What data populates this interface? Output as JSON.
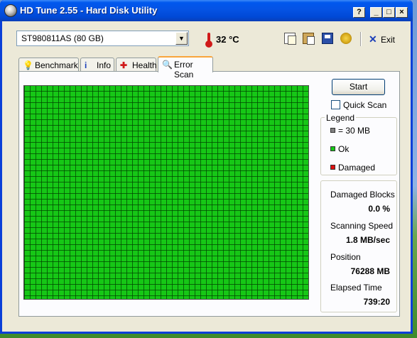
{
  "window": {
    "title": "HD Tune 2.55 - Hard Disk Utility",
    "controls": {
      "help": "?",
      "minimize": "_",
      "maximize": "□",
      "close": "×"
    }
  },
  "toolbar": {
    "drive": "ST980811AS (80 GB)",
    "temperature": "32 °C",
    "icons": [
      "copy-icon",
      "paste-icon",
      "save-icon",
      "options-icon"
    ],
    "exit_label": "Exit"
  },
  "tabs": [
    {
      "label": "Benchmark",
      "icon": "benchmark-icon"
    },
    {
      "label": "Info",
      "icon": "info-icon"
    },
    {
      "label": "Health",
      "icon": "health-icon"
    },
    {
      "label": "Error Scan",
      "icon": "error-scan-icon",
      "active": true
    }
  ],
  "error_scan": {
    "start_label": "Start",
    "quick_scan_label": "Quick Scan",
    "quick_scan_checked": false,
    "legend": {
      "title": "Legend",
      "items": [
        {
          "label": "= 30 MB",
          "color": "#808080"
        },
        {
          "label": "Ok",
          "color": "#16c716"
        },
        {
          "label": "Damaged",
          "color": "#e01010"
        }
      ]
    },
    "stats": [
      {
        "label": "Damaged Blocks",
        "value": "0.0 %"
      },
      {
        "label": "Scanning Speed",
        "value": "1.8 MB/sec"
      },
      {
        "label": "Position",
        "value": "76288 MB"
      },
      {
        "label": "Elapsed Time",
        "value": "739:20"
      }
    ]
  }
}
